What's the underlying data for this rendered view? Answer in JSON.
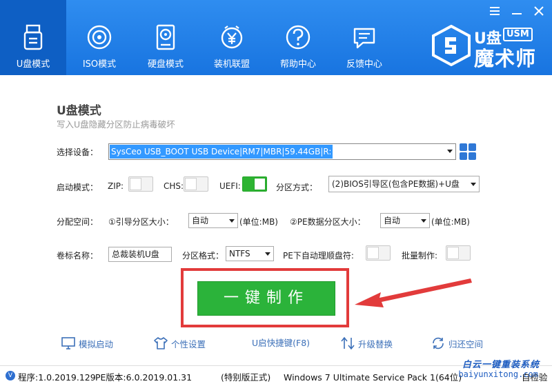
{
  "header": {
    "nav": [
      {
        "label": "U盘模式",
        "icon": "usb-drive-icon",
        "active": true
      },
      {
        "label": "ISO模式",
        "icon": "disc-icon",
        "active": false
      },
      {
        "label": "硬盘模式",
        "icon": "hard-disk-icon",
        "active": false
      },
      {
        "label": "装机联盟",
        "icon": "coin-icon",
        "active": false
      },
      {
        "label": "帮助中心",
        "icon": "question-icon",
        "active": false
      },
      {
        "label": "反馈中心",
        "icon": "chat-icon",
        "active": false
      }
    ],
    "logo": {
      "prefix": "U盘",
      "badge": "USM",
      "name": "魔术师"
    }
  },
  "main": {
    "title": "U盘模式",
    "subtitle": "写入U盘隐藏分区防止病毒破坏",
    "device_label": "选择设备：",
    "device_value": "SysCeo USB_BOOT USB Device|RM7|MBR|59.44GB|R:",
    "boot_mode_label": "启动模式：",
    "zip_label": "ZIP:",
    "chs_label": "CHS:",
    "uefi_label": "UEFI:",
    "partition_mode_label": "分区方式：",
    "partition_mode_value": "(2)BIOS引导区(包含PE数据)+U盘",
    "alloc_label": "分配空间：",
    "boot_size_label": "①引导分区大小：",
    "boot_size_value": "自动",
    "unit_mb_1": "(单位:MB)",
    "pe_size_label": "②PE数据分区大小：",
    "pe_size_value": "自动",
    "unit_mb_2": "(单位:MB)",
    "volume_label": "卷标名称：",
    "volume_value": "总裁装机U盘",
    "format_label": "分区格式：",
    "format_value": "NTFS",
    "pe_auto_label": "PE下自动理顺盘符:",
    "batch_label": "批量制作:",
    "make_button": "一键制作"
  },
  "tools": [
    {
      "label": "模拟启动",
      "icon": "monitor-icon"
    },
    {
      "label": "个性设置",
      "icon": "shirt-icon"
    },
    {
      "label": "U启快捷键(F8)",
      "icon": ""
    },
    {
      "label": "升级替换",
      "icon": "upgrade-icon"
    },
    {
      "label": "归还空间",
      "icon": "refresh-icon"
    }
  ],
  "status": {
    "version": "程序:1.0.2019.129",
    "pe_version": "PE版本:6.0.2019.01.31",
    "edition": "(特别版正式)",
    "os": "Windows 7 Ultimate Service Pack 1(64位)",
    "check": "自检验"
  },
  "watermark": {
    "line1": "白云一键重装系统",
    "line2": "baiyunxitong.com"
  },
  "colors": {
    "header": "#1874e0",
    "active_nav": "#0e5fc4",
    "make_button": "#2bb33a",
    "highlight_frame": "#e23b3b",
    "tool_link": "#3b6fb8"
  }
}
